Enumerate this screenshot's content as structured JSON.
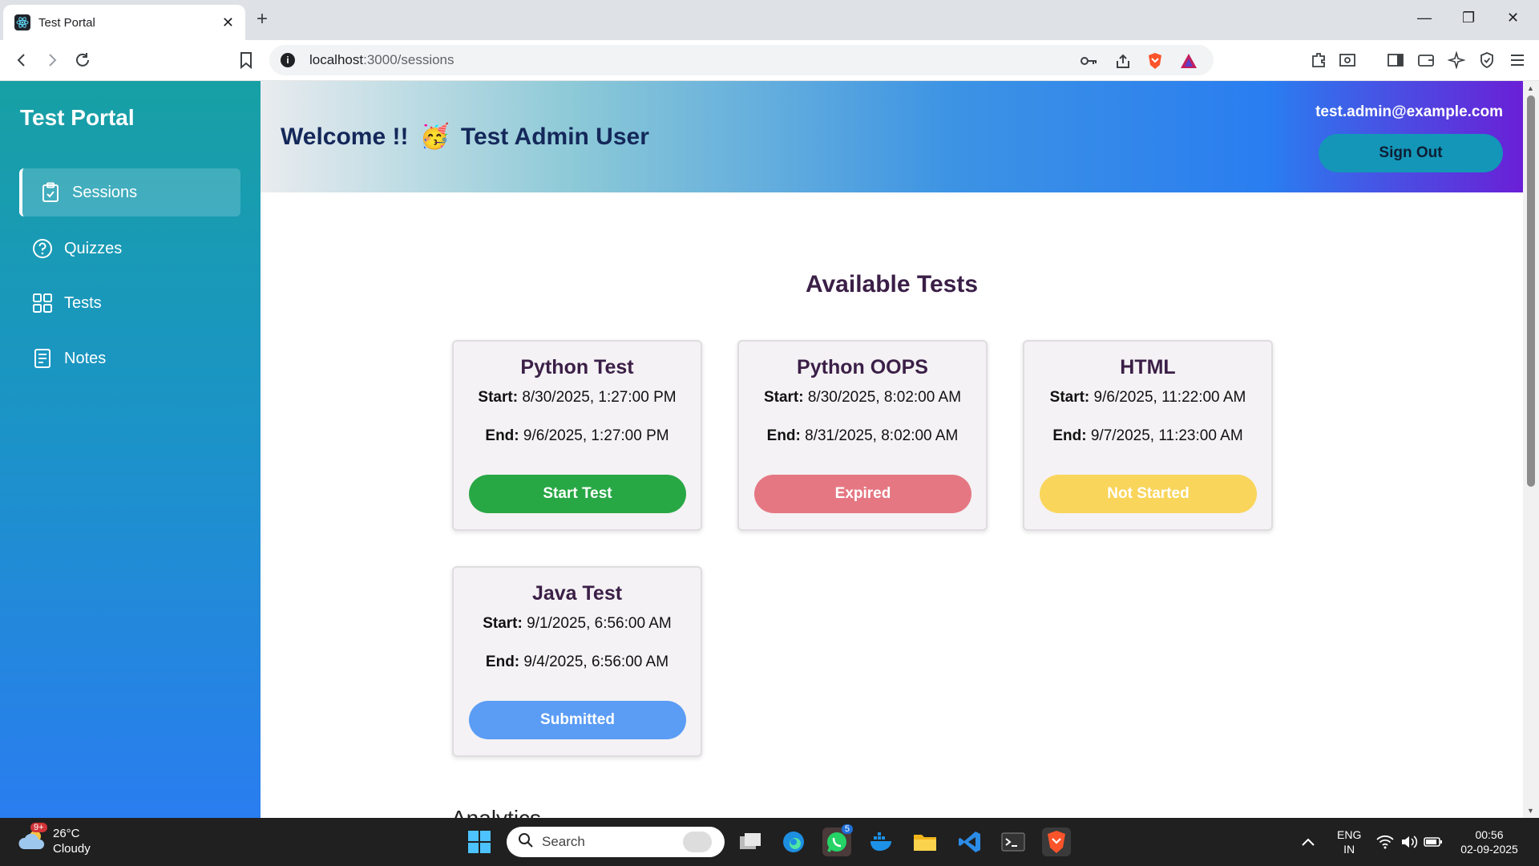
{
  "browser": {
    "tab_title": "Test Portal",
    "new_tab": "+",
    "url_host": "localhost",
    "url_path": ":3000/sessions"
  },
  "sidebar": {
    "brand": "Test Portal",
    "items": [
      {
        "label": "Sessions",
        "icon": "clipboard-check-icon",
        "active": true
      },
      {
        "label": "Quizzes",
        "icon": "question-circle-icon",
        "active": false
      },
      {
        "label": "Tests",
        "icon": "grid-icon",
        "active": false
      },
      {
        "label": "Notes",
        "icon": "notes-icon",
        "active": false
      }
    ]
  },
  "header": {
    "welcome_prefix": "Welcome !!",
    "emoji": "🥳",
    "user_name": "Test Admin User",
    "email": "test.admin@example.com",
    "signout_label": "Sign Out"
  },
  "main": {
    "heading": "Available Tests",
    "start_label": "Start:",
    "end_label": "End:",
    "cards": [
      {
        "title": "Python Test",
        "start": "8/30/2025, 1:27:00 PM",
        "end": "9/6/2025, 1:27:00 PM",
        "button": "Start Test",
        "color": "#28a745"
      },
      {
        "title": "Python OOPS",
        "start": "8/30/2025, 8:02:00 AM",
        "end": "8/31/2025, 8:02:00 AM",
        "button": "Expired",
        "color": "#e57783"
      },
      {
        "title": "HTML",
        "start": "9/6/2025, 11:22:00 AM",
        "end": "9/7/2025, 11:23:00 AM",
        "button": "Not Started",
        "color": "#f9d55b"
      },
      {
        "title": "Java Test",
        "start": "9/1/2025, 6:56:00 AM",
        "end": "9/4/2025, 6:56:00 AM",
        "button": "Submitted",
        "color": "#5b9cf5"
      }
    ],
    "analytics_heading": "Analytics"
  },
  "taskbar": {
    "weather_temp": "26°C",
    "weather_desc": "Cloudy",
    "weather_badge": "9+",
    "search_placeholder": "Search",
    "whatsapp_badge": "5",
    "lang_1": "ENG",
    "lang_2": "IN",
    "time": "00:56",
    "date": "02-09-2025"
  }
}
